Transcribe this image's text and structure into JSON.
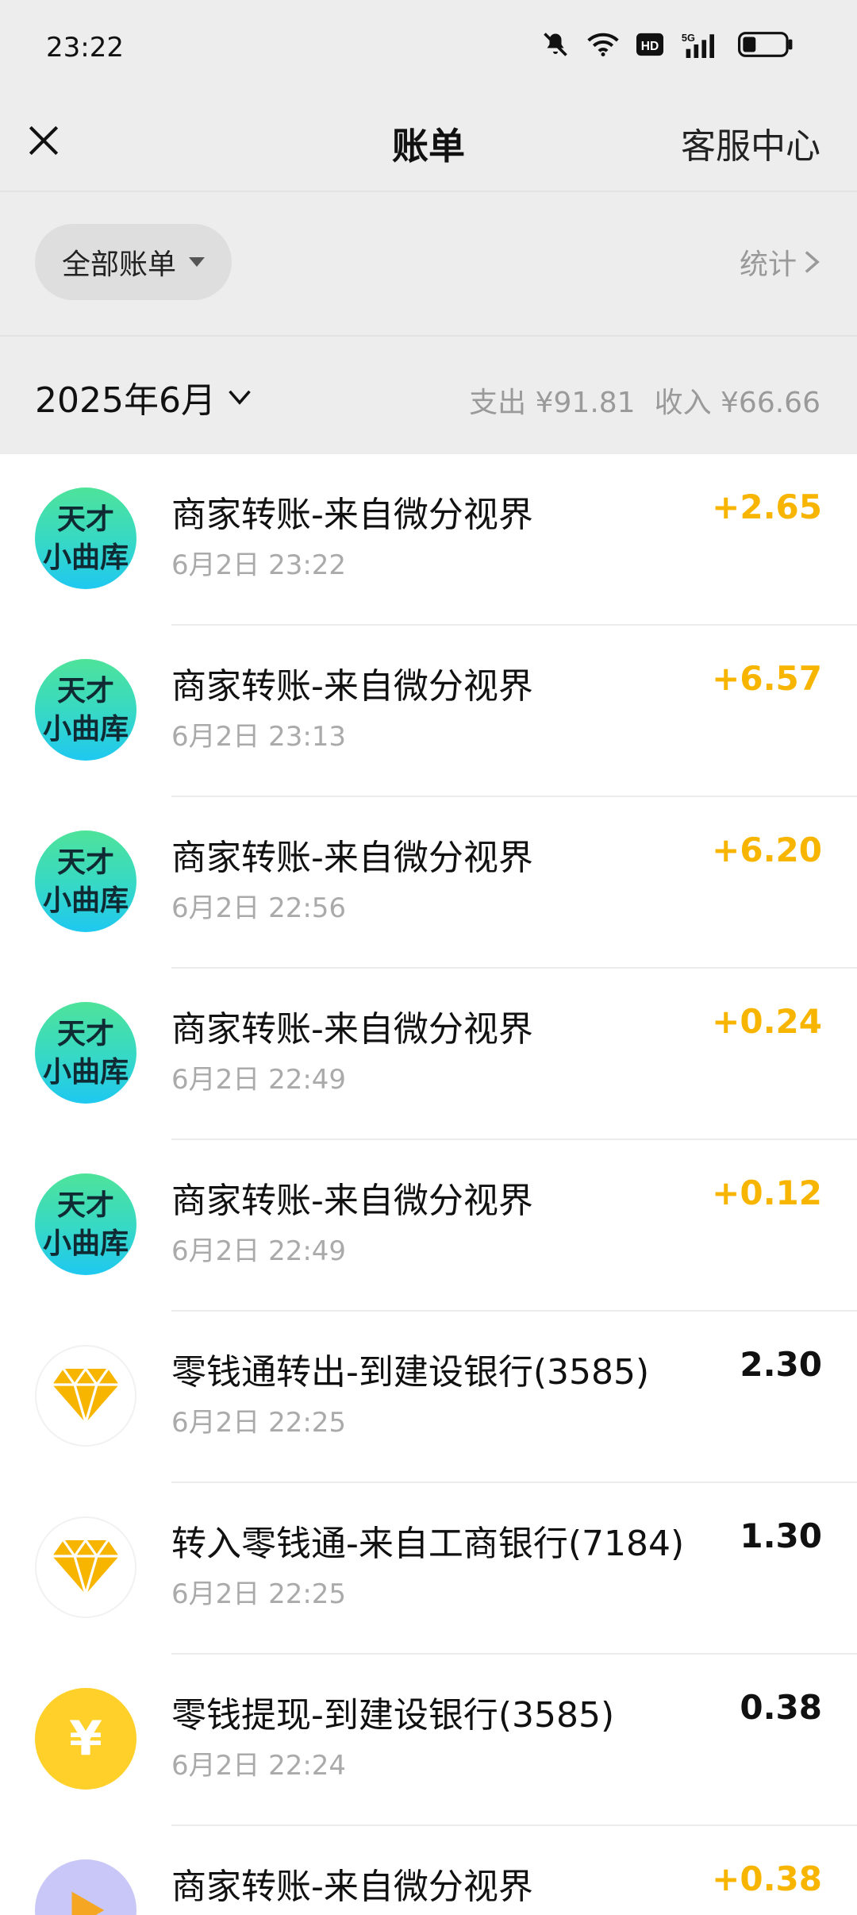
{
  "status_bar": {
    "time": "23:22",
    "icons": [
      "bell-muted-icon",
      "wifi-icon",
      "hd-icon",
      "5g-signal-icon",
      "battery-icon"
    ]
  },
  "navbar": {
    "title": "账单",
    "help_label": "客服中心",
    "close_icon": "close-icon"
  },
  "filter": {
    "selected": "全部账单",
    "stats_label": "统计"
  },
  "month": {
    "label": "2025年6月",
    "expense_summary": "支出 ¥91.81",
    "income_summary": "收入 ¥66.66"
  },
  "colors": {
    "income_amount": "#f7b500",
    "expense_amount": "#111111",
    "page_background": "#ededed"
  },
  "transactions": [
    {
      "avatar": "brand",
      "avatar_text": [
        "天才",
        "小曲库"
      ],
      "title": "商家转账-来自微分视界",
      "time": "6月2日 23:22",
      "amount": "+2.65",
      "type": "income"
    },
    {
      "avatar": "brand",
      "avatar_text": [
        "天才",
        "小曲库"
      ],
      "title": "商家转账-来自微分视界",
      "time": "6月2日 23:13",
      "amount": "+6.57",
      "type": "income"
    },
    {
      "avatar": "brand",
      "avatar_text": [
        "天才",
        "小曲库"
      ],
      "title": "商家转账-来自微分视界",
      "time": "6月2日 22:56",
      "amount": "+6.20",
      "type": "income"
    },
    {
      "avatar": "brand",
      "avatar_text": [
        "天才",
        "小曲库"
      ],
      "title": "商家转账-来自微分视界",
      "time": "6月2日 22:49",
      "amount": "+0.24",
      "type": "income"
    },
    {
      "avatar": "brand",
      "avatar_text": [
        "天才",
        "小曲库"
      ],
      "title": "商家转账-来自微分视界",
      "time": "6月2日 22:49",
      "amount": "+0.12",
      "type": "income"
    },
    {
      "avatar": "diamond",
      "title": "零钱通转出-到建设银行(3585)",
      "time": "6月2日 22:25",
      "amount": "2.30",
      "type": "expense"
    },
    {
      "avatar": "diamond",
      "title": "转入零钱通-来自工商银行(7184)",
      "time": "6月2日 22:25",
      "amount": "1.30",
      "type": "expense"
    },
    {
      "avatar": "coin",
      "avatar_text": [
        "¥"
      ],
      "title": "零钱提现-到建设银行(3585)",
      "time": "6月2日 22:24",
      "amount": "0.38",
      "type": "expense"
    },
    {
      "avatar": "video",
      "title": "商家转账-来自微分视界",
      "time": "",
      "amount": "+0.38",
      "type": "income"
    }
  ]
}
